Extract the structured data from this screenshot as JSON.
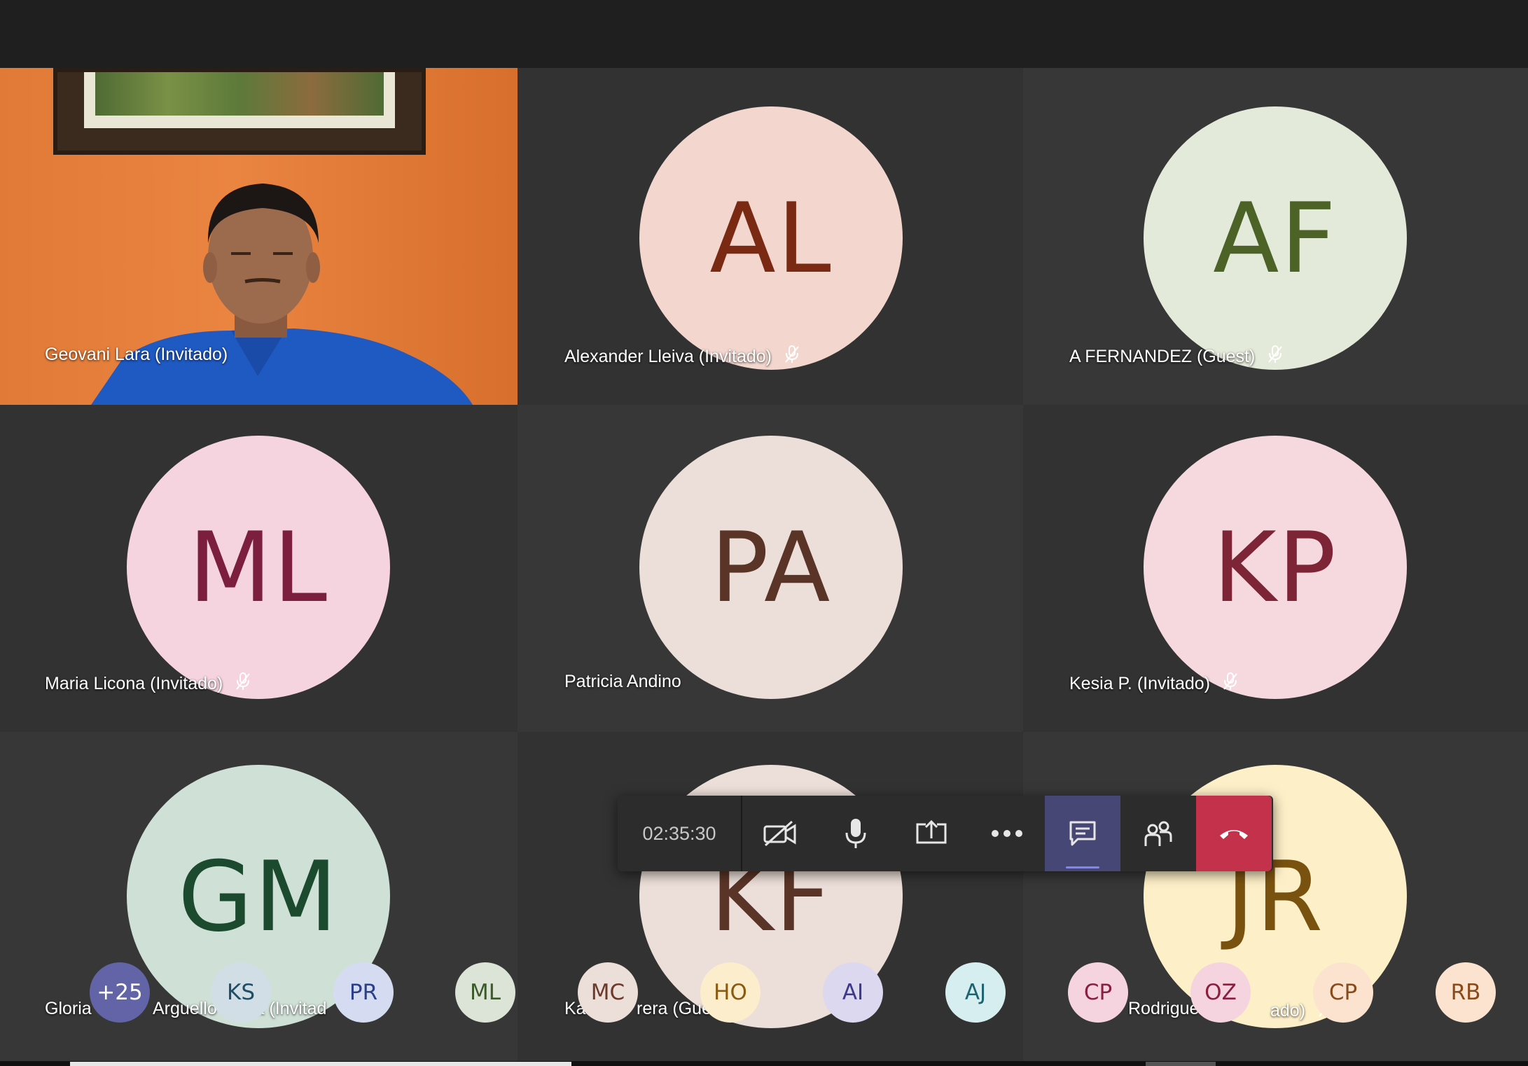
{
  "meeting": {
    "timer": "02:35:30"
  },
  "participants": [
    {
      "initials": "",
      "name": "Geovani Lara (Invitado)",
      "muted": false,
      "video": true
    },
    {
      "initials": "AL",
      "name": "Alexander Lleiva (Invitado)",
      "muted": true,
      "bg": "#f3d7cf",
      "fg": "#7a2a12"
    },
    {
      "initials": "AF",
      "name": "A FERNANDEZ (Guest)",
      "muted": true,
      "bg": "#e4ead9",
      "fg": "#4c6226"
    },
    {
      "initials": "ML",
      "name": "Maria Licona (Invitado)",
      "muted": true,
      "bg": "#f6d4df",
      "fg": "#7c1e3e"
    },
    {
      "initials": "PA",
      "name": "Patricia Andino",
      "muted": false,
      "bg": "#ecded8",
      "fg": "#5a3527"
    },
    {
      "initials": "KP",
      "name": "Kesia P. (Invitado)",
      "muted": true,
      "bg": "#f6d9de",
      "fg": "#7d2436"
    },
    {
      "initials": "GM",
      "name": "Gloria",
      "muted": false,
      "bg": "#cfe0d6",
      "fg": "#1b4a2e"
    },
    {
      "initials": "KF",
      "name": "Ka",
      "muted": false,
      "bg": "#ecded8",
      "fg": "#5a3527"
    },
    {
      "initials": "JR",
      "name": "",
      "muted": true,
      "bg": "#fdefc7",
      "fg": "#7a5210"
    }
  ],
  "name_fragments": {
    "gloria_mid": "Arguello",
    "gloria_end": "ia (Invitad",
    "kf_end": "rera (Gue",
    "jr_mid": "Rodriguez",
    "jr_end": "ado)"
  },
  "roster": [
    {
      "label": "+25",
      "bg": "#6264a7",
      "fg": "#ffffff"
    },
    {
      "label": "KS",
      "bg": "#d1dee6",
      "fg": "#1f4e66"
    },
    {
      "label": "PR",
      "bg": "#d5dcf1",
      "fg": "#2b3f8a"
    },
    {
      "label": "ML",
      "bg": "#dbe4d6",
      "fg": "#3a5a2a"
    },
    {
      "label": "MC",
      "bg": "#ecded8",
      "fg": "#6b3a2a"
    },
    {
      "label": "HO",
      "bg": "#fcedcc",
      "fg": "#8a5a10"
    },
    {
      "label": "AI",
      "bg": "#dbd8f0",
      "fg": "#3d3a8a"
    },
    {
      "label": "AJ",
      "bg": "#d7eef1",
      "fg": "#1e6470"
    },
    {
      "label": "CP",
      "bg": "#f6d4df",
      "fg": "#8a2040"
    },
    {
      "label": "OZ",
      "bg": "#f6d4df",
      "fg": "#8a2040"
    },
    {
      "label": "CP",
      "bg": "#fbe3d0",
      "fg": "#8a4b1a"
    },
    {
      "label": "RB",
      "bg": "#fbe3d0",
      "fg": "#8a4b1a"
    }
  ],
  "icons": {
    "camera_off": "camera-off-icon",
    "mic": "microphone-icon",
    "share": "share-screen-icon",
    "more": "more-options-icon",
    "chat": "chat-icon",
    "people": "participants-icon",
    "hangup": "hang-up-icon",
    "muted": "mic-muted-icon"
  },
  "colors": {
    "hangup": "#c4314b",
    "active": "#464775",
    "stage": "#2d2d2d"
  }
}
